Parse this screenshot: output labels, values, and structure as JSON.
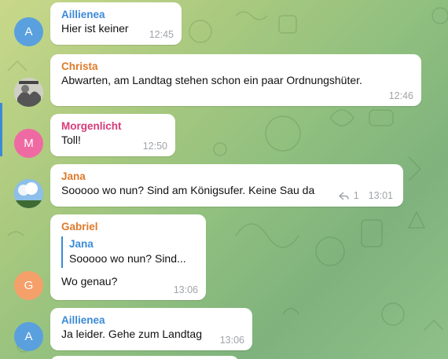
{
  "messages": [
    {
      "sender": "Aillienea",
      "sender_color": "#3b8ad8",
      "avatar_initial": "A",
      "avatar_color": "#5aa0df",
      "text": "Hier ist keiner",
      "time": "12:45"
    },
    {
      "sender": "Christa",
      "sender_color": "#de7a2a",
      "avatar_type": "photo",
      "text": "Abwarten, am Landtag stehen schon ein paar Ordnungshüter.",
      "time": "12:46"
    },
    {
      "sender": "Morgenlicht",
      "sender_color": "#d63b78",
      "avatar_initial": "M",
      "avatar_color": "#ef6aa3",
      "text": "Toll!",
      "time": "12:50"
    },
    {
      "sender": "Jana",
      "sender_color": "#de7a2a",
      "avatar_type": "photo",
      "text": "Sooooo  wo nun? Sind am Königsufer. Keine Sau da",
      "reply_icon": "reply-arrow-icon",
      "reply_count": "1",
      "time": "13:01"
    },
    {
      "sender": "Gabriel",
      "sender_color": "#de7a2a",
      "avatar_initial": "G",
      "avatar_color": "#f5a06a",
      "quote_author": "Jana",
      "quote_text": "Sooooo  wo nun? Sind...",
      "text": "Wo genau?",
      "time": "13:06"
    },
    {
      "sender": "Aillienea",
      "sender_color": "#3b8ad8",
      "avatar_initial": "A",
      "avatar_color": "#5aa0df",
      "text": "Ja leider. Gehe zum Landtag",
      "time": "13:06"
    }
  ]
}
